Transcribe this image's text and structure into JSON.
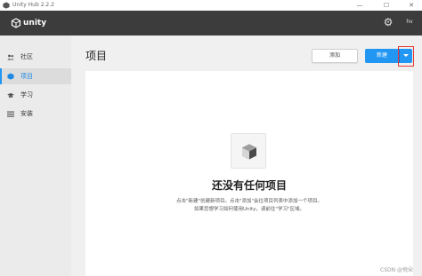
{
  "window": {
    "title": "Unity Hub 2.2.2",
    "minimize_glyph": "—",
    "maximize_glyph": "☐",
    "close_glyph": "✕"
  },
  "header": {
    "logo_text": "unity",
    "settings_icon": "gear-icon",
    "account_label": "hv"
  },
  "sidebar": {
    "items": [
      {
        "label": "社区",
        "icon": "people-icon",
        "glyph": "👥",
        "active": false
      },
      {
        "label": "项目",
        "icon": "cube-icon",
        "glyph": "◆",
        "active": true
      },
      {
        "label": "学习",
        "icon": "graduation-cap-icon",
        "glyph": "🎓",
        "active": false
      },
      {
        "label": "安装",
        "icon": "list-icon",
        "glyph": "☰",
        "active": false
      }
    ]
  },
  "main": {
    "title": "项目",
    "add_label": "添加",
    "new_label": "新建",
    "dropdown_icon": "chevron-down-icon",
    "empty_state": {
      "title": "还没有任何项目",
      "line1": "点击\"新建\"创建新项目。点击\"添加\"会往项目列表中添加一个项目。",
      "line2": "如果您想学习如何使用Unity，请前往\"学习\"区域。"
    },
    "watermark": "CSDN @悦朵"
  },
  "colors": {
    "header_bg": "#3c3c3c",
    "sidebar_bg": "#ebebeb",
    "accent": "#2196f3",
    "highlight": "#e53935"
  }
}
